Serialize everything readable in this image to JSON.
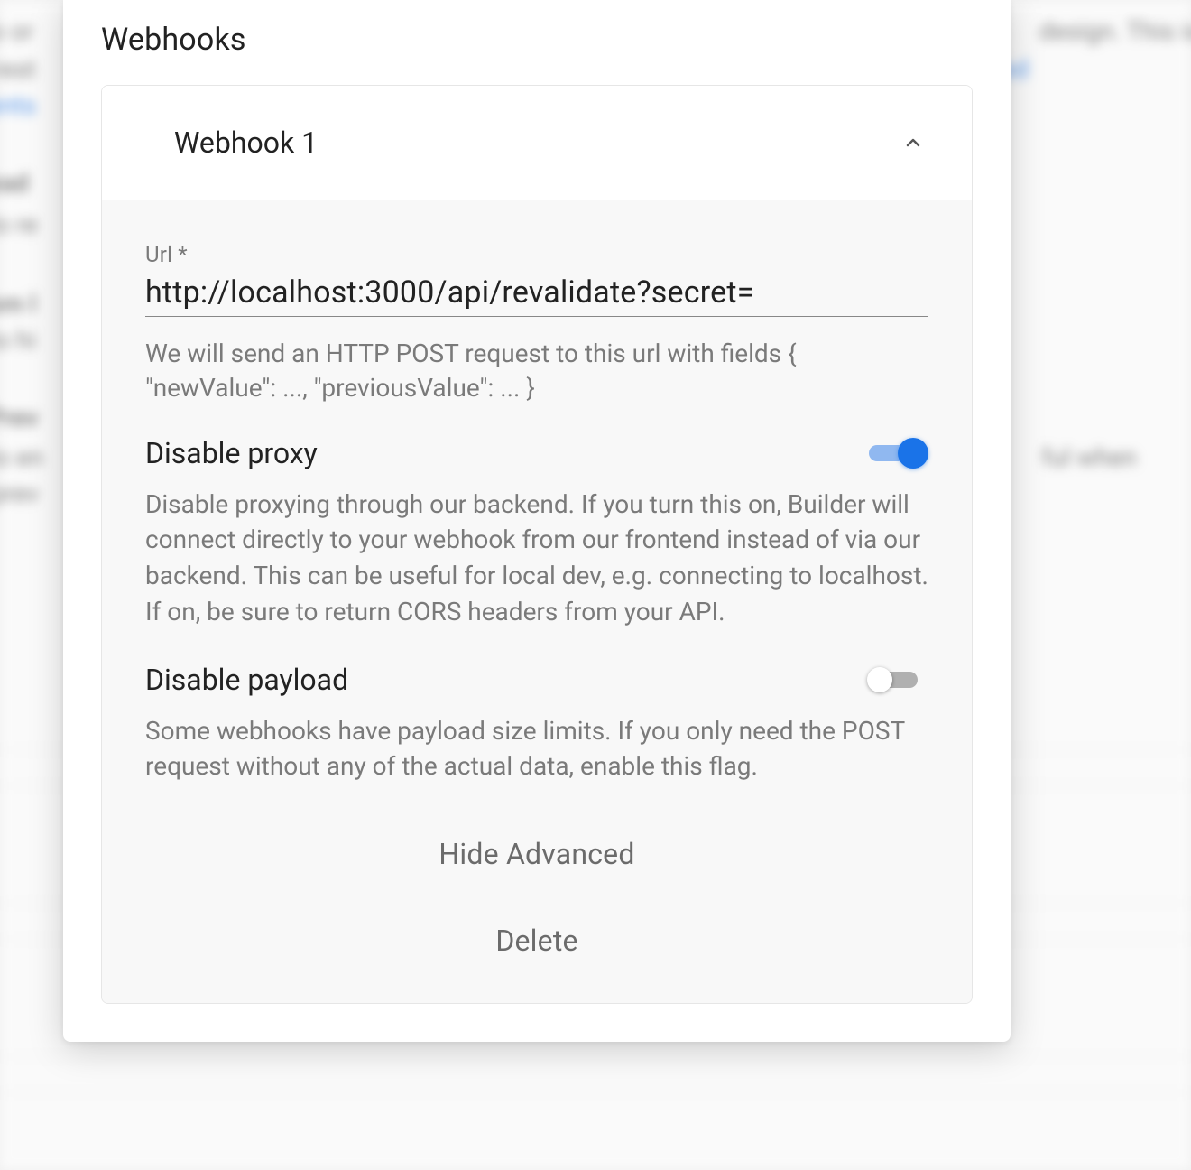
{
  "sectionTitle": "Webhooks",
  "webhook": {
    "title": "Webhook 1",
    "url": {
      "label": "Url *",
      "value": "http://localhost:3000/api/revalidate?secret=",
      "help": "We will send an HTTP POST request to this url with fields { \"newValue\": ..., \"previousValue\": ... }"
    },
    "disableProxy": {
      "label": "Disable proxy",
      "on": true,
      "desc": "Disable proxying through our backend. If you turn this on, Builder will connect directly to your webhook from our frontend instead of via our backend. This can be useful for local dev, e.g. connecting to localhost. If on, be sure to return CORS headers from your API."
    },
    "disablePayload": {
      "label": "Disable payload",
      "on": false,
      "desc": "Some webhooks have payload size limits. If you only need the POST request without any of the actual data, enable this flag."
    },
    "actions": {
      "hideAdvanced": "Hide Advanced",
      "delete": "Delete"
    }
  },
  "bg": {
    "l1": "to or",
    "l2": "rest",
    "l3": "ents",
    "l4": "ead",
    "l5": "to re",
    "l6": "om l",
    "l7": "to hi",
    "l8": "Prev",
    "l9": "to en",
    "l10": "prev",
    "r1": "design. This is",
    "r2": "ed",
    "r3": "ful when"
  }
}
